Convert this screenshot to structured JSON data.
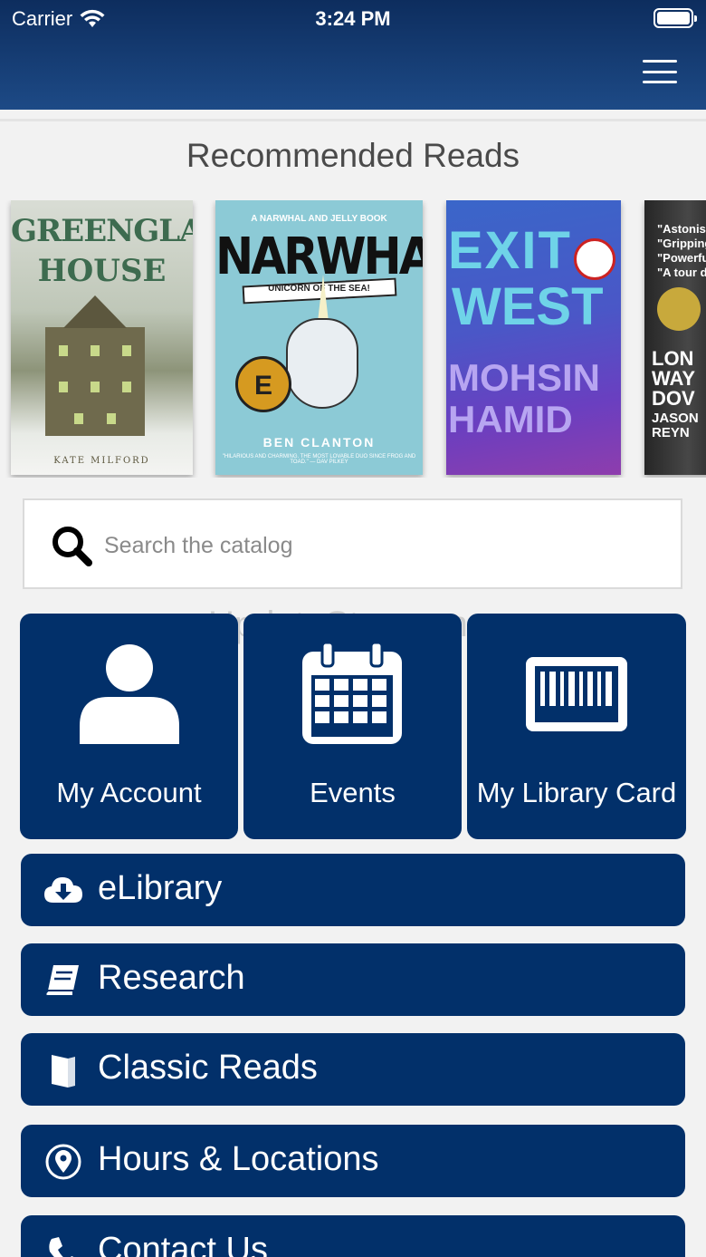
{
  "status_bar": {
    "carrier": "Carrier",
    "time": "3:24 PM"
  },
  "section": {
    "title": "Recommended Reads"
  },
  "covers": [
    {
      "line1": "GREENGLASS",
      "line2": "HOUSE",
      "author": "KATE MILFORD"
    },
    {
      "tagline": "A NARWHAL AND JELLY BOOK",
      "title": "NARWHAL",
      "subtitle": "UNICORN OF THE SEA!",
      "medal": "E",
      "author": "BEN CLANTON",
      "blurb": "\"HILARIOUS AND CHARMING. THE MOST LOVABLE DUO SINCE FROG AND TOAD.\" — DAV PILKEY"
    },
    {
      "line1": "EXIT",
      "line2": "WEST",
      "line3": "MOHSIN",
      "line4": "HAMID"
    },
    {
      "q1": "\"Astonish",
      "q2": "\"Gripping",
      "q3": "\"Powerfu",
      "q4": "\"A tour d",
      "t1": "LON",
      "t2": "WAY",
      "t3": "DOV",
      "a1": "JASON",
      "a2": "REYN"
    }
  ],
  "search": {
    "placeholder": "Search the catalog"
  },
  "watermark": "UpdateStar.com",
  "tiles": [
    {
      "label": "My Account",
      "icon": "user-icon"
    },
    {
      "label": "Events",
      "icon": "calendar-icon"
    },
    {
      "label": "My Library Card",
      "icon": "barcode-icon"
    }
  ],
  "menu_rows": [
    {
      "label": "eLibrary",
      "icon": "cloud-download-icon"
    },
    {
      "label": "Research",
      "icon": "book-icon"
    },
    {
      "label": "Classic Reads",
      "icon": "book-open-icon"
    },
    {
      "label": "Hours & Locations",
      "icon": "map-pin-icon"
    },
    {
      "label": "Contact Us",
      "icon": "phone-icon"
    }
  ],
  "colors": {
    "header": "#0d2d5e",
    "button": "#02306a",
    "background": "#f2f2f2"
  }
}
